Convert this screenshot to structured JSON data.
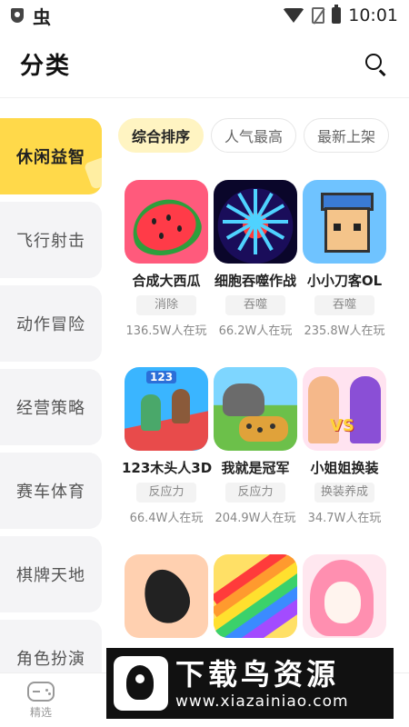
{
  "status_bar": {
    "time": "10:01",
    "app_glyph": "虫"
  },
  "header": {
    "title": "分类"
  },
  "sidebar": {
    "items": [
      {
        "label": "休闲益智",
        "active": true
      },
      {
        "label": "飞行射击"
      },
      {
        "label": "动作冒险"
      },
      {
        "label": "经营策略"
      },
      {
        "label": "赛车体育"
      },
      {
        "label": "棋牌天地"
      },
      {
        "label": "角色扮演"
      }
    ]
  },
  "sort_tabs": [
    {
      "label": "综合排序",
      "active": true
    },
    {
      "label": "人气最高"
    },
    {
      "label": "最新上架"
    }
  ],
  "games": [
    {
      "name": "合成大西瓜",
      "tag": "消除",
      "players": "136.5W人在玩",
      "icon": "watermelon-icon"
    },
    {
      "name": "细胞吞噬作战",
      "tag": "吞噬",
      "players": "66.2W人在玩",
      "icon": "cell-icon"
    },
    {
      "name": "小小刀客OL",
      "tag": "吞噬",
      "players": "235.8W人在玩",
      "icon": "knight-icon"
    },
    {
      "name": "123木头人3D",
      "tag": "反应力",
      "players": "66.4W人在玩",
      "icon": "runner-icon"
    },
    {
      "name": "我就是冠军",
      "tag": "反应力",
      "players": "204.9W人在玩",
      "icon": "animal-icon"
    },
    {
      "name": "小姐姐换装",
      "tag": "换装养成",
      "players": "34.7W人在玩",
      "icon": "dressup-icon"
    },
    {
      "name": "",
      "tag": "",
      "players": "",
      "icon": "egg-icon"
    },
    {
      "name": "",
      "tag": "",
      "players": "",
      "icon": "rainbow-roll-icon"
    },
    {
      "name": "",
      "tag": "",
      "players": "",
      "icon": "girl-face-icon"
    }
  ],
  "game_icon_labels": {
    "runner_number": "123"
  },
  "bottom_nav": {
    "first_label": "精选"
  },
  "watermark": {
    "title": "下载鸟资源",
    "url": "www.xiazainiao.com"
  },
  "colors": {
    "accent": "#ffd94a",
    "active_tab_bg": "#fff4c2"
  }
}
